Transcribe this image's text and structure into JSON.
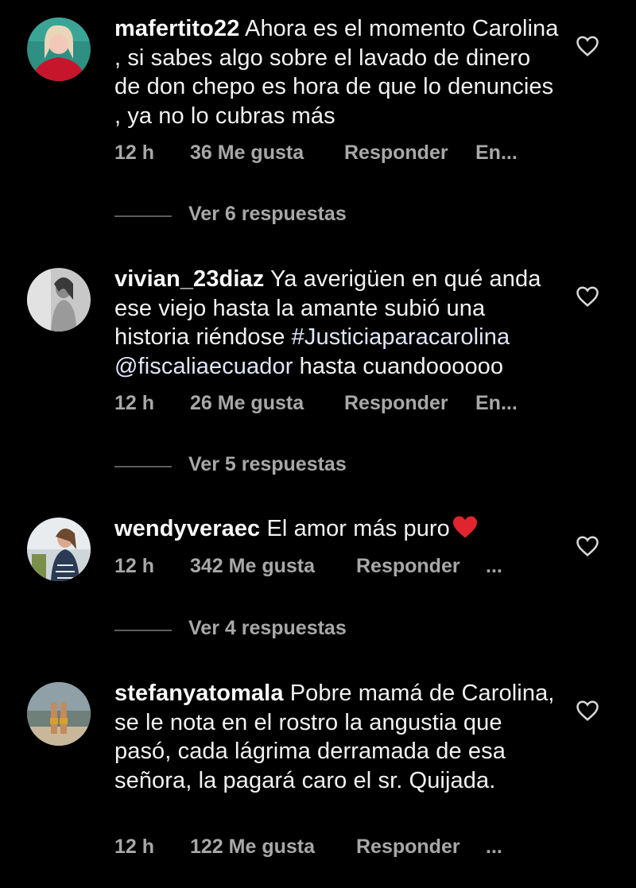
{
  "comments": [
    {
      "username": "mafertito22",
      "text": "Ahora es el momento Carolina , si sabes algo sobre el lavado de dinero de don chepo es hora de que lo denuncies , ya no lo cubras más",
      "time": "12 h",
      "likes": "36 Me gusta",
      "reply": "Responder",
      "extra": "En...",
      "view_replies": "Ver 6 respuestas",
      "avatar_icon": "profile-photo-icon"
    },
    {
      "username": "vivian_23diaz",
      "text_before": "Ya averigüen en qué anda ese viejo hasta la amante subió una historia riéndose ",
      "hashtag": "#Justiciaparacarolina",
      "mention": "@fiscaliaecuador",
      "text_after": " hasta cuandoooooo",
      "time": "12 h",
      "likes": "26 Me gusta",
      "reply": "Responder",
      "extra": "En...",
      "view_replies": "Ver 5 respuestas",
      "avatar_icon": "profile-photo-icon"
    },
    {
      "username": "wendyveraec",
      "text": "El amor más puro",
      "emoji": "red-heart-emoji",
      "time": "12 h",
      "likes": "342 Me gusta",
      "reply": "Responder",
      "extra": "...",
      "view_replies": "Ver 4 respuestas",
      "avatar_icon": "profile-photo-icon"
    },
    {
      "username": "stefanyatomala",
      "text": "Pobre mamá de Carolina, se le nota en el rostro la angustia que pasó, cada lágrima derramada de esa señora, la pagará caro el sr. Quijada.",
      "time": "12 h",
      "likes": "122 Me gusta",
      "reply": "Responder",
      "extra": "...",
      "avatar_icon": "profile-photo-icon"
    }
  ],
  "colors": {
    "background": "#000000",
    "text": "#f2f2f2",
    "meta": "#a8a8a8",
    "heart_emoji": "#e0252e"
  },
  "icons": {
    "like": "heart-outline-icon"
  }
}
